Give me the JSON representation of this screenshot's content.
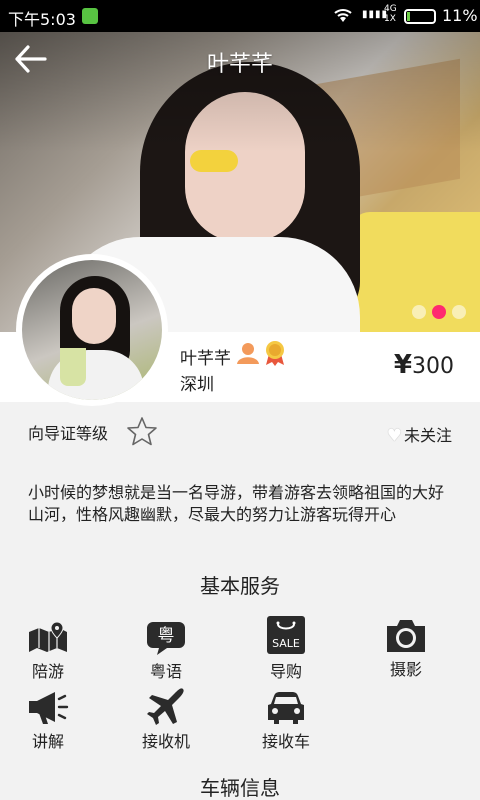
{
  "status_bar": {
    "time": "下午5:03",
    "network_label_top": "4G",
    "network_label_bottom": "1X",
    "battery_percent": "11%",
    "battery_level": 0.11
  },
  "header": {
    "title": "叶芊芊"
  },
  "carousel": {
    "page_count": 3,
    "active_index": 1,
    "active_color": "#ff2a6f"
  },
  "profile": {
    "name": "叶芊芊",
    "city": "深圳",
    "price_symbol": "¥",
    "price_value": "300"
  },
  "guide_level": {
    "label": "向导证等级",
    "stars_filled": 0
  },
  "follow": {
    "label": "未关注",
    "icon": "heart-icon"
  },
  "bio": "小时候的梦想就是当一名导游，带着游客去领略祖国的大好山河，性格风趣幽默，尽最大的努力让游客玩得开心",
  "services": {
    "title": "基本服务",
    "items": [
      {
        "label": "陪游",
        "icon": "map-icon"
      },
      {
        "label": "粤语",
        "icon": "cantonese-speech-icon",
        "icon_text": "粤"
      },
      {
        "label": "导购",
        "icon": "shopping-bag-icon",
        "icon_text": "SALE"
      },
      {
        "label": "摄影",
        "icon": "camera-icon"
      },
      {
        "label": "讲解",
        "icon": "megaphone-icon"
      },
      {
        "label": "接收机",
        "icon": "airplane-icon"
      },
      {
        "label": "接收车",
        "icon": "car-icon"
      }
    ]
  },
  "vehicle": {
    "title": "车辆信息"
  },
  "colors": {
    "background": "#f2f2f2",
    "accent_pink": "#ff2a6f",
    "badge_orange": "#f39a5b",
    "icon_dark": "#2b2b2b"
  }
}
